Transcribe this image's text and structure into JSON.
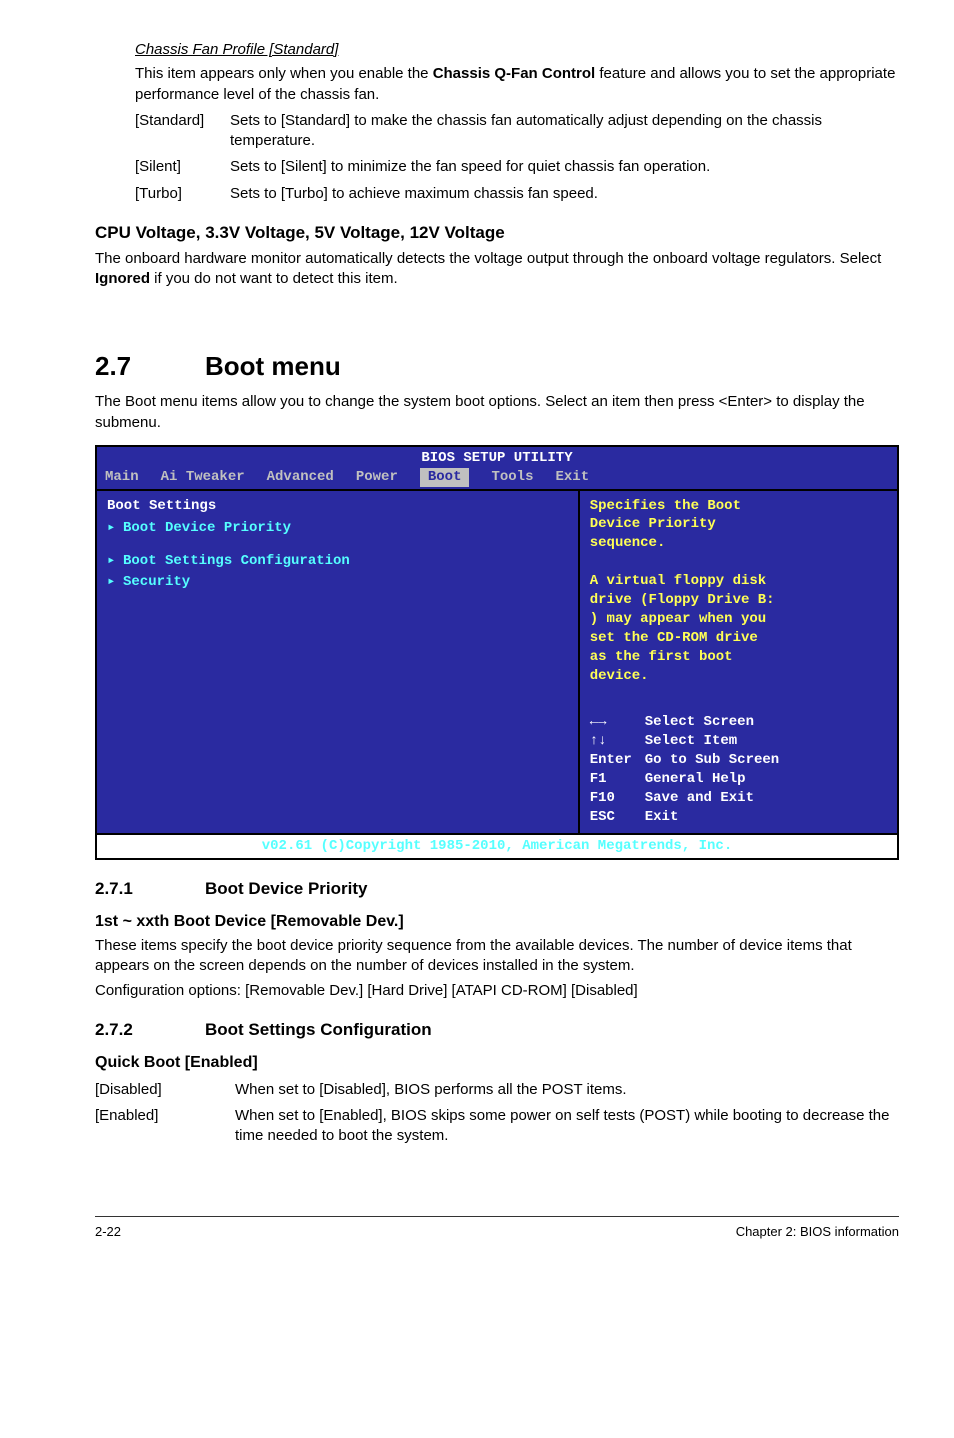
{
  "sec1": {
    "underline": "Chassis Fan Profile [Standard]",
    "intro": "This item appears only when you enable the Chassis Q-Fan Control feature and allows you to set the appropriate performance level of the chassis fan.",
    "intro_prefix": "This item appears only when you enable the ",
    "intro_bold": "Chassis Q-Fan Control",
    "intro_suffix": " feature and allows you to set the appropriate performance level of the chassis fan.",
    "opts": [
      {
        "k": "[Standard]",
        "v": "Sets to [Standard] to make the chassis fan automatically adjust depending on the chassis temperature."
      },
      {
        "k": "[Silent]",
        "v": "Sets to [Silent] to minimize the fan speed for quiet chassis fan operation."
      },
      {
        "k": "[Turbo]",
        "v": "Sets to [Turbo] to achieve maximum chassis fan speed."
      }
    ]
  },
  "cpu": {
    "heading": "CPU Voltage, 3.3V Voltage, 5V Voltage, 12V Voltage",
    "body_prefix": "The onboard hardware monitor automatically detects the voltage output through the onboard voltage regulators. Select ",
    "body_bold": "Ignored",
    "body_suffix": " if you do not want to detect this item."
  },
  "boot": {
    "num": "2.7",
    "title": "Boot menu",
    "intro": "The Boot menu items allow you to change the system boot options. Select an item then press <Enter> to display the submenu."
  },
  "bios": {
    "title": "BIOS SETUP UTILITY",
    "tabs": [
      "Main",
      "Ai Tweaker",
      "Advanced",
      "Power",
      "Boot",
      "Tools",
      "Exit"
    ],
    "active_tab_index": 4,
    "left": {
      "heading": "Boot Settings",
      "items": [
        "Boot Device Priority",
        "Boot Settings Configuration",
        "Security"
      ]
    },
    "help_lines": [
      "Specifies the Boot",
      "Device Priority",
      "sequence.",
      "",
      "A virtual floppy disk",
      "drive (Floppy Drive B:",
      ") may appear when you",
      "set the CD-ROM drive",
      "as the first boot",
      "device."
    ],
    "nav": [
      {
        "k": "←→",
        "v": "Select Screen"
      },
      {
        "k": "↑↓",
        "v": "Select Item"
      },
      {
        "k": "Enter",
        "v": "Go to Sub Screen"
      },
      {
        "k": "F1",
        "v": "General Help"
      },
      {
        "k": "F10",
        "v": "Save and Exit"
      },
      {
        "k": "ESC",
        "v": "Exit"
      }
    ],
    "footer": "v02.61 (C)Copyright 1985-2010, American Megatrends, Inc."
  },
  "sec271": {
    "num": "2.7.1",
    "title": "Boot Device Priority",
    "h4": "1st ~ xxth Boot Device [Removable Dev.]",
    "p1": "These items specify the boot device priority sequence from the available devices. The number of device items that appears on the screen depends on the number of devices installed in the system.",
    "p2": "Configuration options: [Removable Dev.] [Hard Drive] [ATAPI CD-ROM] [Disabled]"
  },
  "sec272": {
    "num": "2.7.2",
    "title": "Boot Settings Configuration",
    "h4": "Quick Boot [Enabled]",
    "opts": [
      {
        "k": "[Disabled]",
        "v": "When set to [Disabled], BIOS performs all the POST items."
      },
      {
        "k": "[Enabled]",
        "v": "When set to [Enabled], BIOS skips some power on self tests (POST) while booting to decrease the time needed to boot the system."
      }
    ]
  },
  "footer": {
    "left": "2-22",
    "right": "Chapter 2: BIOS information"
  }
}
